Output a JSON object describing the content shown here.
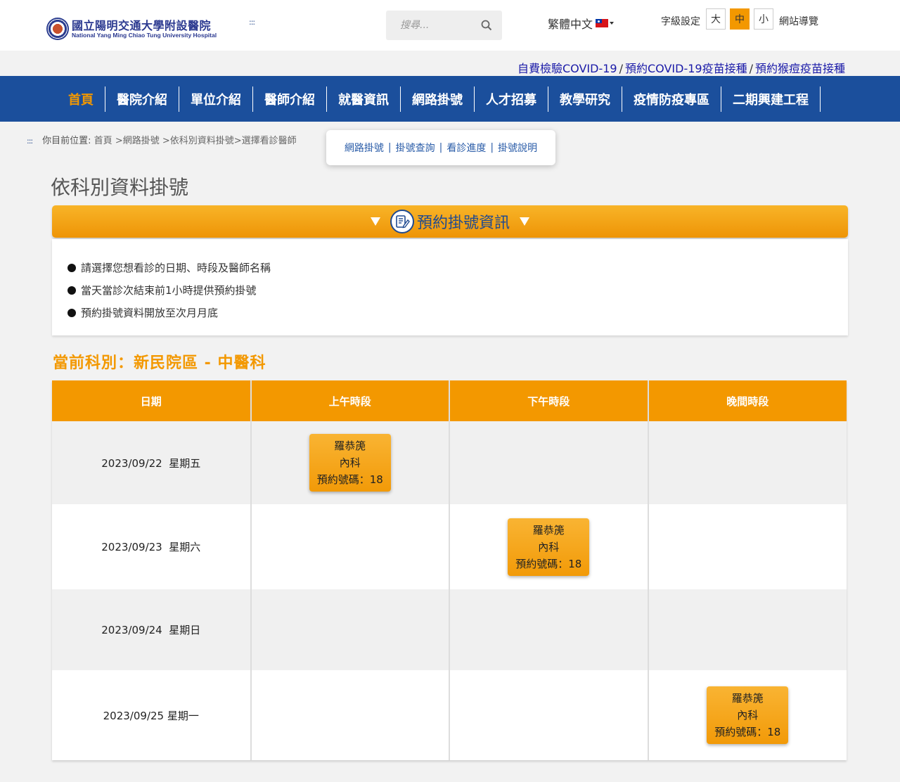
{
  "header": {
    "logo_cn": "國立陽明交通大學附設醫院",
    "logo_en": "National Yang Ming Chiao Tung University Hospital",
    "accesskey": ":::",
    "search_placeholder": "搜尋...",
    "language": "繁體中文",
    "font_size_label": "字級設定",
    "font_sizes": [
      "大",
      "中",
      "小"
    ],
    "font_size_selected": "中",
    "sitemap": "網站導覽"
  },
  "quick_links": {
    "link1": "自費檢驗COVID-19",
    "link2": "預約COVID-19疫苗接種",
    "link3": "預約猴痘疫苗接種",
    "separator": "/"
  },
  "nav": {
    "items": [
      "首頁",
      "醫院介紹",
      "單位介紹",
      "醫師介紹",
      "就醫資訊",
      "網路掛號",
      "人才招募",
      "教學研究",
      "疫情防疫專區",
      "二期興建工程"
    ],
    "active": "首頁"
  },
  "breadcrumb": {
    "accesskey": ":::",
    "label": "你目前位置:",
    "path": [
      "首頁",
      ">網路掛號",
      ">依科別資料掛號",
      ">選擇看診醫師"
    ]
  },
  "submenu": {
    "items": [
      "網路掛號",
      "掛號查詢",
      "看診進度",
      "掛號說明"
    ],
    "separator": "|"
  },
  "page_title": "依科別資料掛號",
  "info_bar_title": "預約掛號資訊",
  "info_items": [
    "請選擇您想看診的日期、時段及醫師名稱",
    "當天當診次結束前1小時提供預約掛號",
    "預約掛號資料開放至次月月底"
  ],
  "department": "當前科別：新民院區 - 中醫科",
  "table": {
    "headers": [
      "日期",
      "上午時段",
      "下午時段",
      "晚間時段"
    ],
    "rows": [
      {
        "date": "2023/09/22  星期五",
        "slot": "morning"
      },
      {
        "date": "2023/09/23  星期六",
        "slot": "afternoon"
      },
      {
        "date": "2023/09/24  星期日",
        "slot": "none"
      },
      {
        "date": "2023/09/25 星期一",
        "slot": "evening"
      }
    ],
    "card": {
      "doctor": "羅恭箎",
      "specialty": "內科",
      "number_label": "預約號碼：18"
    }
  },
  "colors": {
    "nav_blue": "#1b4f9c",
    "accent_orange": "#f39800",
    "link_blue": "#1a1aa8"
  }
}
